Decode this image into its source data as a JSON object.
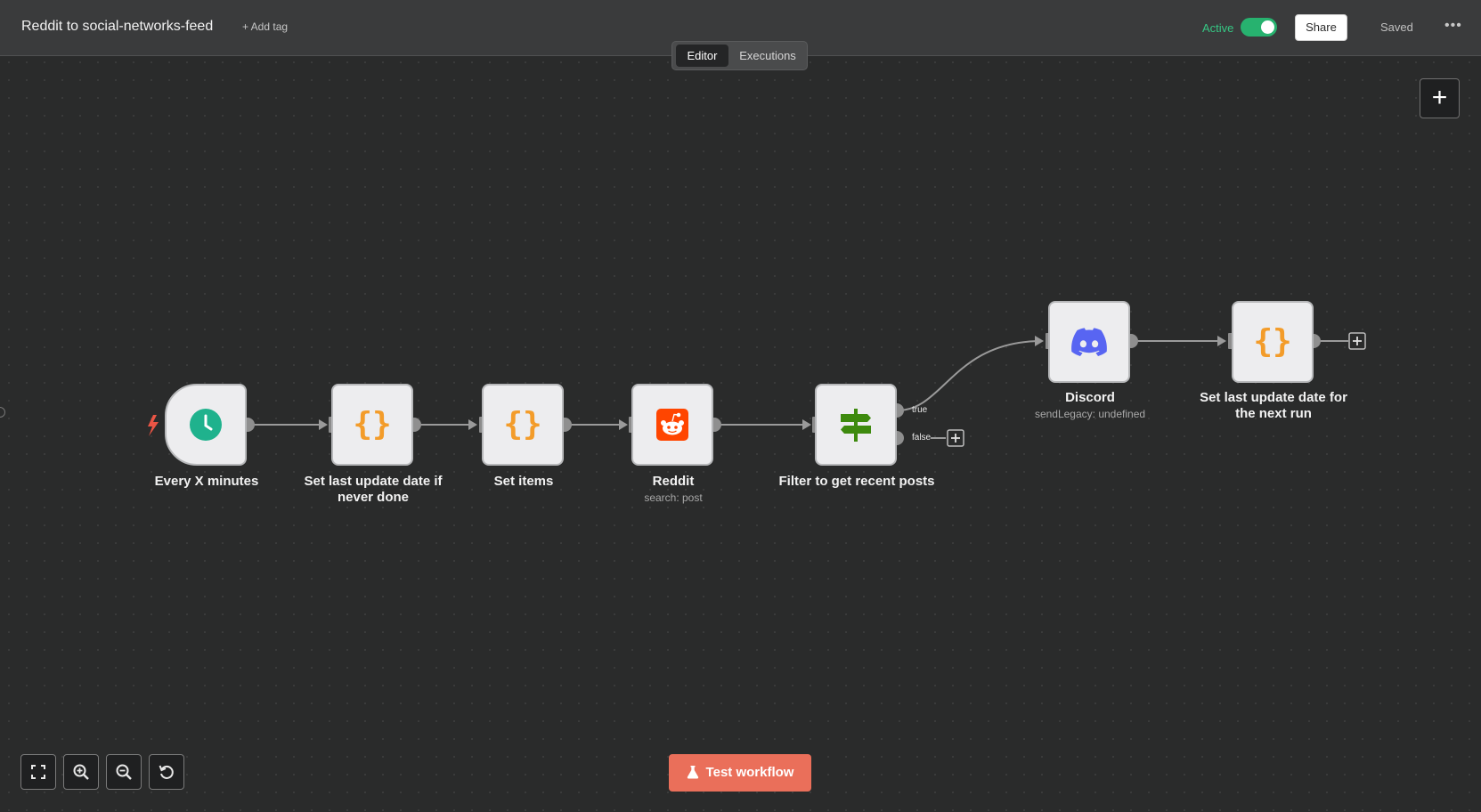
{
  "header": {
    "title": "Reddit to social-networks-feed",
    "add_tag": "+ Add tag",
    "active_label": "Active",
    "active": true,
    "share": "Share",
    "saved": "Saved",
    "more": "•••"
  },
  "view_toggle": {
    "editor": "Editor",
    "executions": "Executions",
    "selected": "Editor"
  },
  "nodes": [
    {
      "id": "every-x-minutes",
      "label": "Every X minutes",
      "subtitle": "",
      "icon": "clock-icon",
      "kind": "trigger"
    },
    {
      "id": "set-last-update-date-if-never-done",
      "label": "Set last update date if never done",
      "subtitle": "",
      "icon": "curly-braces-icon",
      "kind": "set"
    },
    {
      "id": "set-items",
      "label": "Set items",
      "subtitle": "",
      "icon": "curly-braces-icon",
      "kind": "set"
    },
    {
      "id": "reddit",
      "label": "Reddit",
      "subtitle": "search: post",
      "icon": "reddit-icon",
      "kind": "app"
    },
    {
      "id": "filter-to-get-recent-posts",
      "label": "Filter to get recent posts",
      "subtitle": "",
      "icon": "signpost-icon",
      "kind": "if"
    },
    {
      "id": "discord",
      "label": "Discord",
      "subtitle": "sendLegacy: undefined",
      "icon": "discord-icon",
      "kind": "app"
    },
    {
      "id": "set-last-update-date-for-the-next-run",
      "label": "Set last update date for the next run",
      "subtitle": "",
      "icon": "curly-braces-icon",
      "kind": "set"
    }
  ],
  "ports": {
    "true_label": "true",
    "false_label": "false"
  },
  "icons": {
    "curly": "{}",
    "plus": "+"
  },
  "controls": {
    "zoom_to_fit": "zoom-to-fit-icon",
    "zoom_in": "zoom-in-icon",
    "zoom_out": "zoom-out-icon",
    "reset_zoom": "reset-zoom-icon"
  },
  "test_button": {
    "label": "Test workflow",
    "icon": "flask-icon"
  },
  "colors": {
    "canvas_bg": "#2a2b2b",
    "accent_active": "#27b26f",
    "test_button": "#ea6f5a",
    "set_icon": "#f39c2a",
    "reddit": "#ff4500",
    "discord": "#5865f2",
    "clock": "#1fb28d",
    "filter": "#3e8a0e",
    "trigger_bolt": "#ea5545"
  }
}
